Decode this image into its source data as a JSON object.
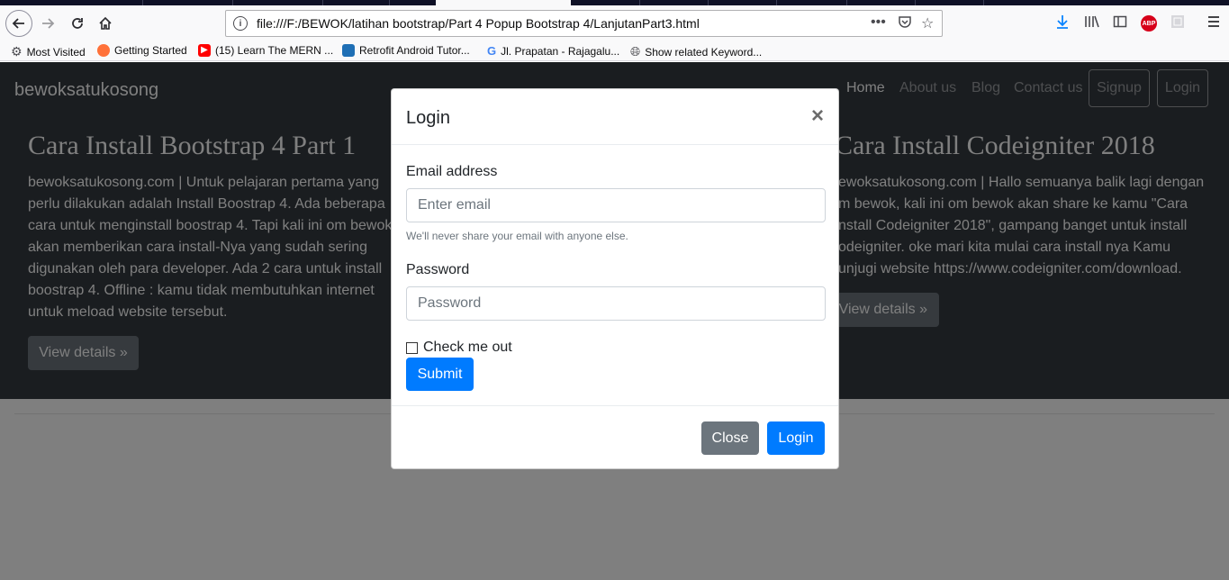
{
  "browser": {
    "url": "file:///F:/BEWOK/latihan bootstrap/Part 4 Popup Bootstrap 4/LanjutanPart3.html",
    "bookmarks": [
      {
        "label": "Most Visited",
        "icon": "gear-icon"
      },
      {
        "label": "Getting Started",
        "icon": "firefox-icon"
      },
      {
        "label": "(15) Learn The MERN ...",
        "icon": "youtube-icon"
      },
      {
        "label": "Retrofit Android Tutor...",
        "icon": "bookmark-icon"
      },
      {
        "label": "Jl. Prapatan - Rajagalu...",
        "icon": "google-icon"
      },
      {
        "label": "Show related Keyword...",
        "icon": "globe-icon"
      }
    ],
    "abp_label": "ABP"
  },
  "site": {
    "brand": "bewoksatukosong",
    "nav": {
      "home": "Home",
      "about": "About us",
      "blog": "Blog",
      "contact": "Contact us",
      "signup": "Signup",
      "login": "Login"
    },
    "columns": [
      {
        "title": "Cara Install Bootstrap 4 Part 1",
        "text_lines": [
          "bewoksatukosong.com | Untuk pelajaran pertama yang",
          "perlu dilakukan adalah Install Boostrap 4. Ada beberapa",
          "cara untuk menginstall boostrap 4. Tapi kali ini om bewok",
          "akan memberikan cara install-Nya yang sudah sering",
          "digunakan oleh para developer. Ada 2 cara untuk install",
          "boostrap 4. Offline : kamu tidak membutuhkan internet",
          "untuk meload website tersebut."
        ],
        "button": "View details »"
      },
      {
        "title": "Cara Install Codeigniter 2018",
        "text_lines": [
          "ewoksatukosong.com | Hallo semuanya balik lagi dengan",
          "m bewok, kali ini om bewok akan share ke kamu \"Cara",
          "nstall Codeigniter 2018\", gampang banget untuk install",
          "odeigniter. oke mari kita mulai cara install nya Kamu",
          "unjugi website https://www.codeigniter.com/download."
        ],
        "button": "View details »"
      }
    ]
  },
  "modal": {
    "title": "Login",
    "close_symbol": "×",
    "email_label": "Email address",
    "email_placeholder": "Enter email",
    "email_help": "We'll never share your email with anyone else.",
    "password_label": "Password",
    "password_placeholder": "Password",
    "check_label": "Check me out",
    "submit": "Submit",
    "footer_close": "Close",
    "footer_login": "Login"
  },
  "colors": {
    "primary": "#007bff",
    "secondary": "#6c757d",
    "dark": "#343a40"
  }
}
